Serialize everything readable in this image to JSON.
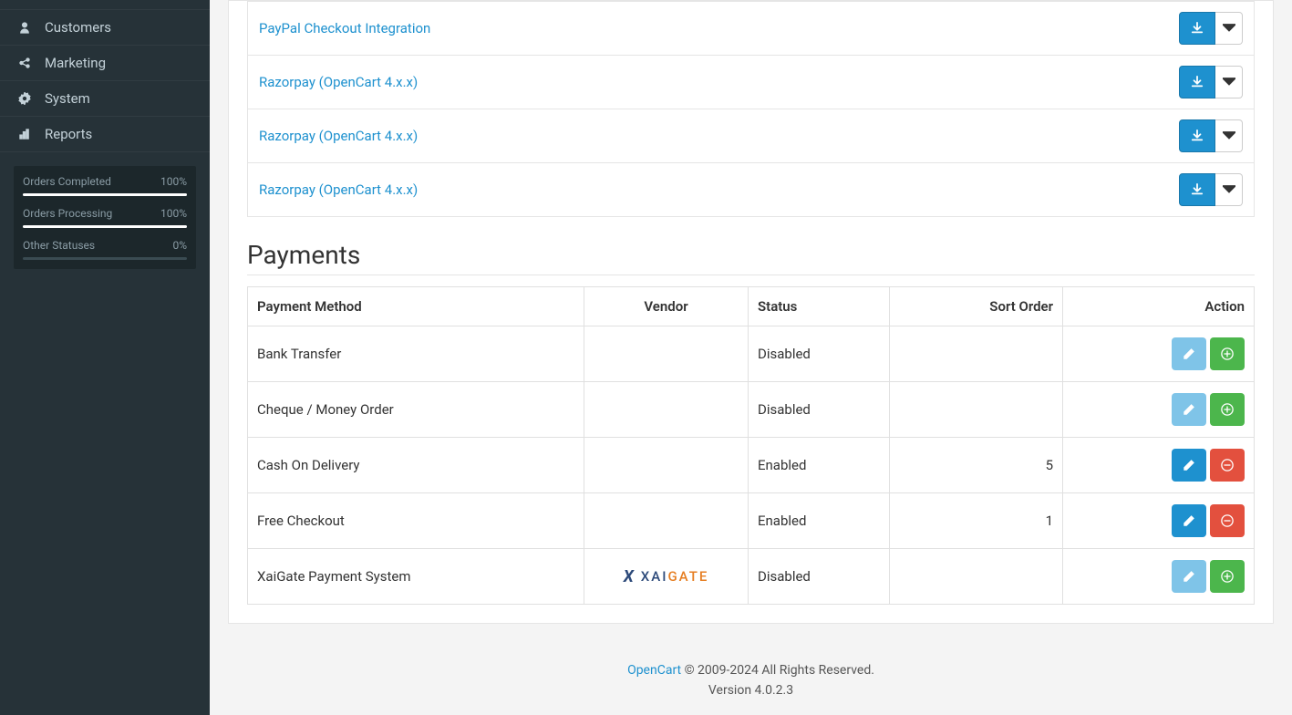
{
  "sidebar": {
    "items": [
      {
        "label": "Customers"
      },
      {
        "label": "Marketing"
      },
      {
        "label": "System"
      },
      {
        "label": "Reports"
      }
    ],
    "stats": [
      {
        "label": "Orders Completed",
        "value": "100%",
        "pct": 100
      },
      {
        "label": "Orders Processing",
        "value": "100%",
        "pct": 100
      },
      {
        "label": "Other Statuses",
        "value": "0%",
        "pct": 0
      }
    ]
  },
  "extensions": [
    {
      "name": "PayPal Checkout Integration"
    },
    {
      "name": "Razorpay (OpenCart 4.x.x)"
    },
    {
      "name": "Razorpay (OpenCart 4.x.x)"
    },
    {
      "name": "Razorpay (OpenCart 4.x.x)"
    }
  ],
  "payments_title": "Payments",
  "payments": {
    "columns": {
      "method": "Payment Method",
      "vendor": "Vendor",
      "status": "Status",
      "sort": "Sort Order",
      "action": "Action"
    },
    "rows": [
      {
        "method": "Bank Transfer",
        "vendor": "",
        "status": "Disabled",
        "sort": "",
        "enabled": false
      },
      {
        "method": "Cheque / Money Order",
        "vendor": "",
        "status": "Disabled",
        "sort": "",
        "enabled": false
      },
      {
        "method": "Cash On Delivery",
        "vendor": "",
        "status": "Enabled",
        "sort": "5",
        "enabled": true
      },
      {
        "method": "Free Checkout",
        "vendor": "",
        "status": "Enabled",
        "sort": "1",
        "enabled": true
      },
      {
        "method": "XaiGate Payment System",
        "vendor": "XAIGATE",
        "status": "Disabled",
        "sort": "",
        "enabled": false
      }
    ]
  },
  "footer": {
    "brand": "OpenCart",
    "rights": " © 2009-2024 All Rights Reserved.",
    "version": "Version 4.0.2.3"
  }
}
